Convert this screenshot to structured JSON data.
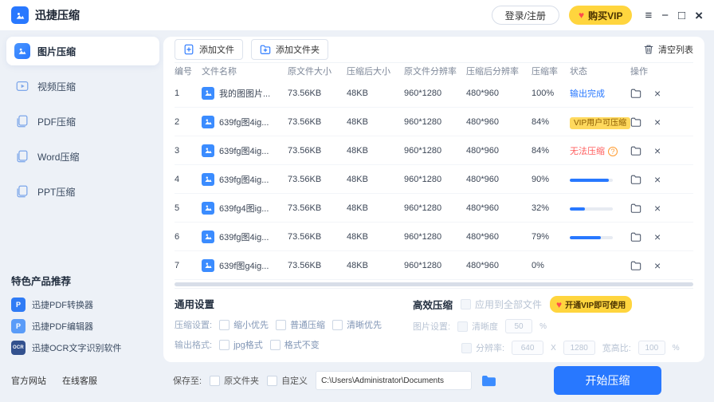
{
  "colors": {
    "accent": "#2878ff",
    "vip_yellow": "#ffd53e",
    "status_done_blue": "#2878ff",
    "status_error_red": "#ff5c5c",
    "warn_orange": "#ff9a2e",
    "page_background": "#edf1f7"
  },
  "icons": {
    "heart": "♥",
    "menu": "≡",
    "minimize": "−",
    "maximize": "□",
    "close": "×",
    "remove": "×",
    "help": "?"
  },
  "topbar": {
    "title": "迅捷压缩",
    "login": "登录/注册",
    "buy_vip": "购买VIP"
  },
  "sidebar": {
    "items": [
      {
        "label": "图片压缩"
      },
      {
        "label": "视频压缩"
      },
      {
        "label": "PDF压缩"
      },
      {
        "label": "Word压缩"
      },
      {
        "label": "PPT压缩"
      }
    ],
    "products_title": "特色产品推荐",
    "products": [
      {
        "label": "迅捷PDF转换器",
        "icon_text": "P"
      },
      {
        "label": "迅捷PDF编辑器",
        "icon_text": "P"
      },
      {
        "label": "迅捷OCR文字识别软件",
        "icon_text": "OCR"
      }
    ],
    "site_link": "官方网站",
    "support_link": "在线客服"
  },
  "toolbar": {
    "add_file": "添加文件",
    "add_folder": "添加文件夹",
    "clear_list": "清空列表"
  },
  "table": {
    "headers": [
      "编号",
      "文件名称",
      "原文件大小",
      "压缩后大小",
      "原文件分辨率",
      "压缩后分辨率",
      "压缩率",
      "状态",
      "操作"
    ],
    "rows": [
      {
        "no": "1",
        "name": "我的图图片...",
        "orig_size": "73.56KB",
        "new_size": "48KB",
        "orig_res": "960*1280",
        "new_res": "480*960",
        "rate": "100%",
        "status_type": "done",
        "status": "输出完成"
      },
      {
        "no": "2",
        "name": "639fg图4ig...",
        "orig_size": "73.56KB",
        "new_size": "48KB",
        "orig_res": "960*1280",
        "new_res": "480*960",
        "rate": "84%",
        "status_type": "vip",
        "status": "VIP用户可压缩"
      },
      {
        "no": "3",
        "name": "639fg图4ig...",
        "orig_size": "73.56KB",
        "new_size": "48KB",
        "orig_res": "960*1280",
        "new_res": "480*960",
        "rate": "84%",
        "status_type": "error",
        "status": "无法压缩"
      },
      {
        "no": "4",
        "name": "639fg图4ig...",
        "orig_size": "73.56KB",
        "new_size": "48KB",
        "orig_res": "960*1280",
        "new_res": "480*960",
        "rate": "90%",
        "status_type": "progress",
        "progress": 90
      },
      {
        "no": "5",
        "name": "639fg4图ig...",
        "orig_size": "73.56KB",
        "new_size": "48KB",
        "orig_res": "960*1280",
        "new_res": "480*960",
        "rate": "32%",
        "status_type": "progress",
        "progress": 35
      },
      {
        "no": "6",
        "name": "639fg图4ig...",
        "orig_size": "73.56KB",
        "new_size": "48KB",
        "orig_res": "960*1280",
        "new_res": "480*960",
        "rate": "79%",
        "status_type": "progress",
        "progress": 72
      },
      {
        "no": "7",
        "name": "639f图g4ig...",
        "orig_size": "73.56KB",
        "new_size": "48KB",
        "orig_res": "960*1280",
        "new_res": "480*960",
        "rate": "0%",
        "status_type": "none",
        "status": ""
      }
    ]
  },
  "settings": {
    "general_title": "通用设置",
    "compress_label": "压缩设置:",
    "compress_options": [
      "缩小优先",
      "普通压缩",
      "清晰优先"
    ],
    "format_label": "输出格式:",
    "format_options": [
      "jpg格式",
      "格式不变"
    ],
    "efficient_title": "高效压缩",
    "apply_all_label": "应用到全部文件",
    "vip_badge": "开通VIP即可使用",
    "image_label": "图片设置:",
    "clarity_label": "清晰度",
    "clarity_value": "50",
    "resolution_label": "分辨率:",
    "res_width": "640",
    "times_label": "X",
    "res_height": "1280",
    "ratio_label": "宽高比:",
    "ratio_value": "100",
    "percent": "%"
  },
  "bottom": {
    "save_label": "保存至:",
    "save_original": "原文件夹",
    "save_custom": "自定义",
    "path": "C:\\Users\\Administrator\\Documents",
    "start": "开始压缩"
  }
}
